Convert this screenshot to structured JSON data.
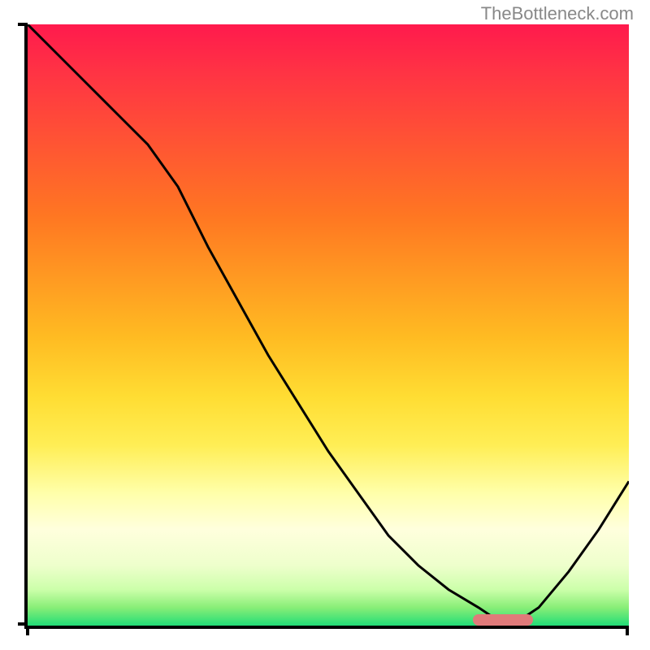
{
  "watermark": "TheBottleneck.com",
  "chart_data": {
    "type": "line",
    "title": "",
    "xlabel": "",
    "ylabel": "",
    "x": [
      0,
      5,
      10,
      15,
      20,
      25,
      30,
      35,
      40,
      45,
      50,
      55,
      60,
      65,
      70,
      75,
      78,
      80,
      82,
      85,
      90,
      95,
      100
    ],
    "values": [
      100,
      95,
      90,
      85,
      80,
      73,
      63,
      54,
      45,
      37,
      29,
      22,
      15,
      10,
      6,
      3,
      1,
      0,
      1,
      3,
      9,
      16,
      24
    ],
    "xlim": [
      0,
      100
    ],
    "ylim": [
      0,
      100
    ],
    "marker_x_range": [
      74,
      84
    ],
    "marker_y": 1
  }
}
